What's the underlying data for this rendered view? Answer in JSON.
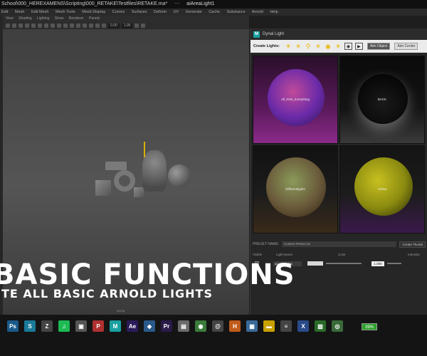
{
  "titlebar": {
    "path": "School\\000_HEREXAMENS\\Scripting\\000_RETAKE\\Testfiles\\RETAKE.ma*",
    "separator": "---",
    "selection": "aiAreaLight1"
  },
  "menubar": {
    "items": [
      "Edit",
      "Mesh",
      "Edit Mesh",
      "Mesh Tools",
      "Mesh Display",
      "Curves",
      "Surfaces",
      "Deform",
      "UV",
      "Generate",
      "Cache",
      "Substance",
      "Arnold",
      "Help"
    ]
  },
  "viewport": {
    "menu": [
      "View",
      "Shading",
      "Lighting",
      "Show",
      "Renderer",
      "Panels"
    ],
    "field_a": "0.00",
    "field_b": "1.00",
    "camera_label": "persp"
  },
  "panel": {
    "title": "Dynal Light",
    "create_label": "Create Lights:",
    "light_icons": [
      "sun-icon",
      "sun-icon",
      "spot-icon",
      "sun-icon",
      "sphere-icon",
      "sun-icon"
    ],
    "aim_object_label": "Aim Object",
    "aim_center_label": "Aim Center",
    "presets": [
      {
        "name": "All_Pink_Everything"
      },
      {
        "name": "BACK"
      },
      {
        "name": "Differentlights"
      },
      {
        "name": "Yellow"
      }
    ],
    "preset_name_label": "PRESET NAME:",
    "preset_name_value": "Custom Preset 1w",
    "create_thumbnail_label": "Create Thumb",
    "headers": {
      "visible": "Visible",
      "light_name": "Light Name",
      "color": "Color",
      "intensity": "Intensity"
    },
    "lights": [
      {
        "visible": "✓",
        "name": "aiAreaLight1",
        "intensity": "1.000"
      }
    ]
  },
  "overlay": {
    "title": "BASIC FUNCTIONS",
    "subtitle": "TE ALL BASIC ARNOLD LIGHTS"
  },
  "taskbar": {
    "apps": [
      {
        "icon": "photoshop-icon",
        "label": "Ps",
        "color": "#1a5a8a"
      },
      {
        "icon": "app-s-icon",
        "label": "S",
        "color": "#1a7a9a"
      },
      {
        "icon": "zbrush-icon",
        "label": "Z",
        "color": "#444444"
      },
      {
        "icon": "spotify-icon",
        "label": "♫",
        "color": "#1db954"
      },
      {
        "icon": "app-box-icon",
        "label": "▣",
        "color": "#555555"
      },
      {
        "icon": "popcorn-icon",
        "label": "P",
        "color": "#b03030"
      },
      {
        "icon": "maya-icon",
        "label": "M",
        "color": "#1aa0a0"
      },
      {
        "icon": "after-effects-icon",
        "label": "Ae",
        "color": "#2a1a5a"
      },
      {
        "icon": "app-diamond-icon",
        "label": "◆",
        "color": "#2a5a8a"
      },
      {
        "icon": "premiere-icon",
        "label": "Pr",
        "color": "#2a1a4a"
      },
      {
        "icon": "folder-icon",
        "label": "▤",
        "color": "#6a6a6a"
      },
      {
        "icon": "chrome-icon",
        "label": "◉",
        "color": "#3a7a3a"
      },
      {
        "icon": "app-swirl-icon",
        "label": "@",
        "color": "#444444"
      },
      {
        "icon": "houdini-icon",
        "label": "H",
        "color": "#c05a1a"
      },
      {
        "icon": "app-map-icon",
        "label": "▦",
        "color": "#3a6a9a"
      },
      {
        "icon": "notes-icon",
        "label": "▬",
        "color": "#c8a000"
      },
      {
        "icon": "app-lines-icon",
        "label": "≡",
        "color": "#444444"
      },
      {
        "icon": "xcode-icon",
        "label": "X",
        "color": "#2a4a8a"
      },
      {
        "icon": "image-viewer-icon",
        "label": "▧",
        "color": "#2a6a2a"
      },
      {
        "icon": "chrome2-icon",
        "label": "◎",
        "color": "#3a6a3a"
      }
    ],
    "battery": "39%"
  }
}
